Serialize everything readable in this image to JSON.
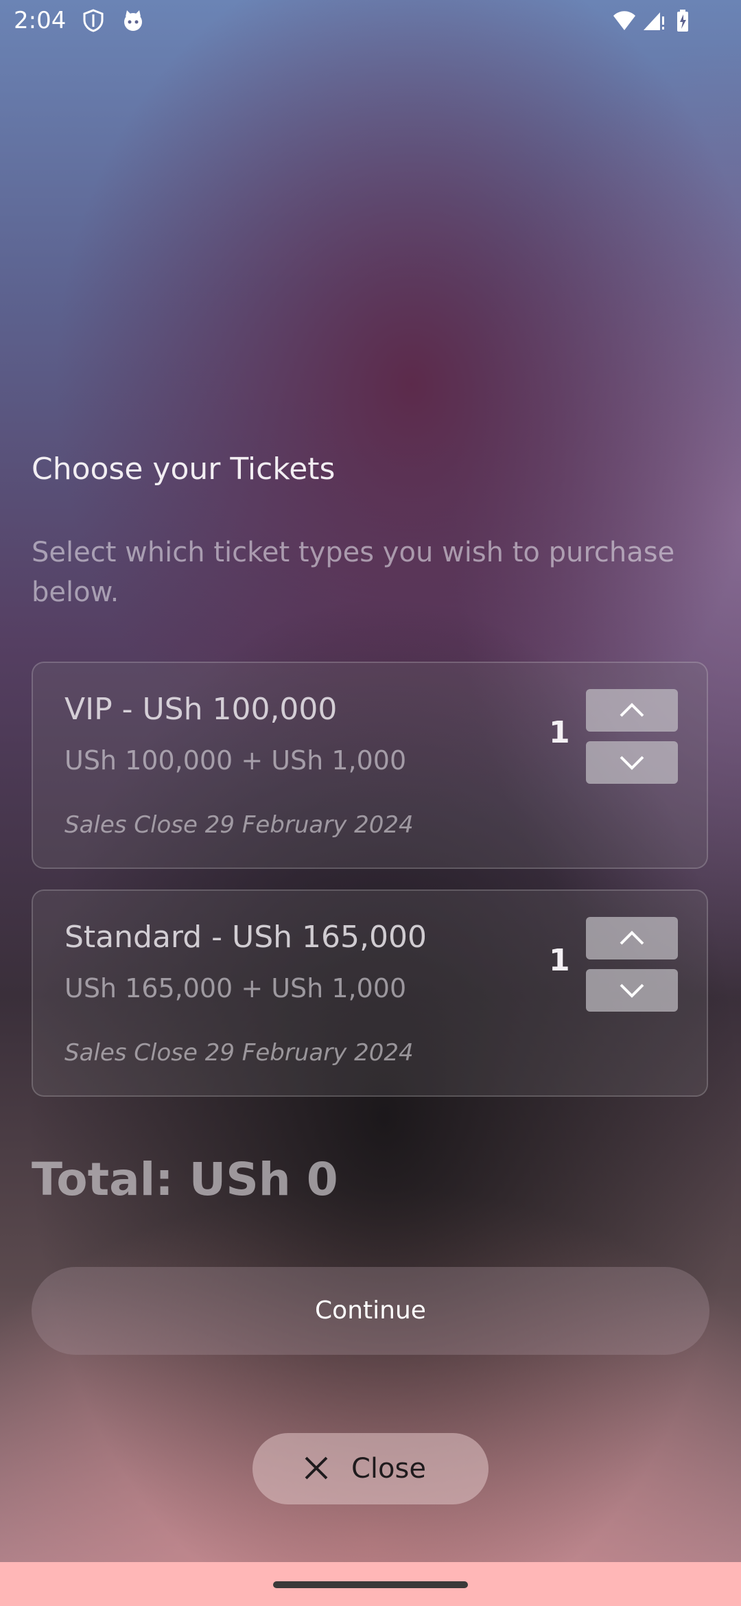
{
  "status_bar": {
    "time": "2:04",
    "icons": [
      "shield-icon",
      "cat-icon",
      "wifi-icon",
      "signal-icon",
      "battery-charging-icon"
    ]
  },
  "header": {
    "title": "Choose your Tickets",
    "subtitle": "Select which ticket types you wish to purchase below."
  },
  "tickets": [
    {
      "name": "VIP - USh 100,000",
      "price_breakdown": "USh 100,000 + USh 1,000",
      "sales_close": "Sales Close 29 February 2024",
      "quantity": "1"
    },
    {
      "name": "Standard - USh 165,000",
      "price_breakdown": "USh 165,000 + USh 1,000",
      "sales_close": "Sales Close 29 February 2024",
      "quantity": "1"
    }
  ],
  "total": "Total: USh 0",
  "continue_label": "Continue",
  "close_label": "Close",
  "colors": {
    "nav_bar": "#ffb7b7",
    "stepper": "#c3c0c6"
  }
}
